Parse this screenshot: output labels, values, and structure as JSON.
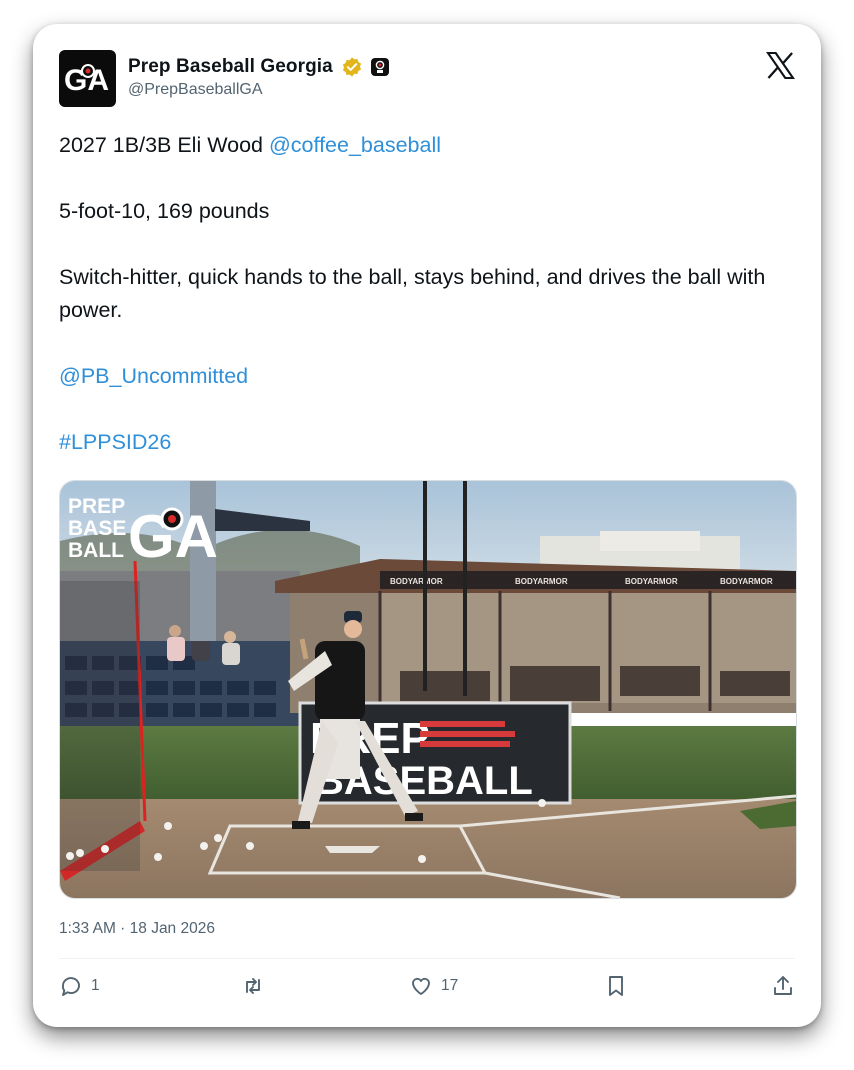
{
  "account": {
    "display_name": "Prep Baseball Georgia",
    "handle": "@PrepBaseballGA",
    "avatar_text": "GA",
    "verified_badge_color": "#e2b51c"
  },
  "tweet": {
    "line1_text": "2027 1B/3B Eli Wood ",
    "line1_mention": "@coffee_baseball",
    "line2": "5-foot-10, 169 pounds",
    "line3": "Switch-hitter, quick hands to the ball, stays behind, and drives the ball with power.",
    "mention2": "@PB_Uncommitted",
    "hashtag": "#LPPSID26",
    "link_color": "#2f8fd8"
  },
  "media": {
    "watermark_prep": "PREP",
    "watermark_base": "BASE",
    "watermark_ball": "BALL",
    "watermark_ga": "GA",
    "banner_prep": "PREP",
    "banner_baseball": "BASEBALL",
    "dugout_sign": "BODYARMOR"
  },
  "timestamp": "1:33 AM · 18 Jan 2026",
  "actions": {
    "reply_count": "1",
    "like_count": "17"
  },
  "icons": [
    "x-logo-icon",
    "verified-badge-icon",
    "affiliate-badge-icon",
    "reply-icon",
    "retweet-icon",
    "like-icon",
    "bookmark-icon",
    "share-icon"
  ]
}
